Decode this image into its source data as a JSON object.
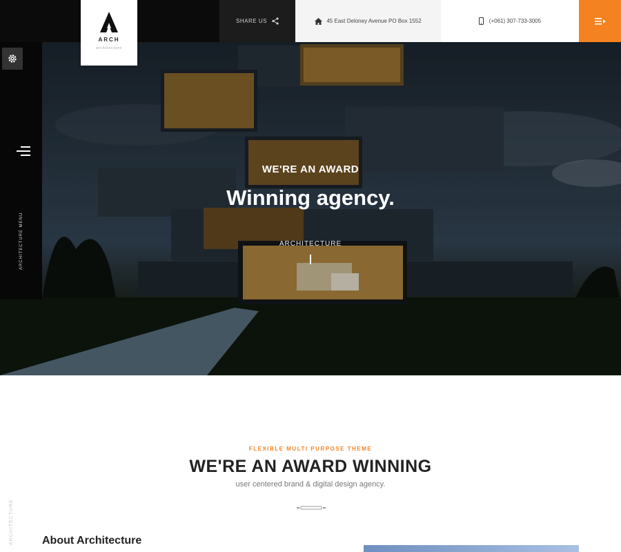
{
  "brand": {
    "name": "ARCH",
    "tagline": "architecture"
  },
  "topbar": {
    "share_label": "SHARE US",
    "address": "45 East Deloney Avenue PO Box 1552",
    "phone": "(+061) 307-733-3005"
  },
  "icons": {
    "share": "share-icon",
    "home": "home-icon",
    "phone": "phone-icon",
    "menu": "menu-icon",
    "gear": "gear-icon",
    "hamburger": "hamburger-icon"
  },
  "sidebar": {
    "vertical_label": "ARCHITECTURE MENU"
  },
  "hero": {
    "kicker": "WE'RE AN AWARD",
    "title": "Winning agency.",
    "subtitle": "ARCHITECTURE"
  },
  "intro": {
    "kicker": "FLEXIBLE MULTI PURPOSE THEME",
    "title": "WE'RE AN AWARD WINNING",
    "subtitle": "user centered brand & digital design agency.",
    "side_label": "ARCHITECTURE"
  },
  "about": {
    "heading": "About Architecture"
  },
  "colors": {
    "accent": "#f58220",
    "dark": "#0b0b0b",
    "highlight": "#fbeeb0"
  }
}
